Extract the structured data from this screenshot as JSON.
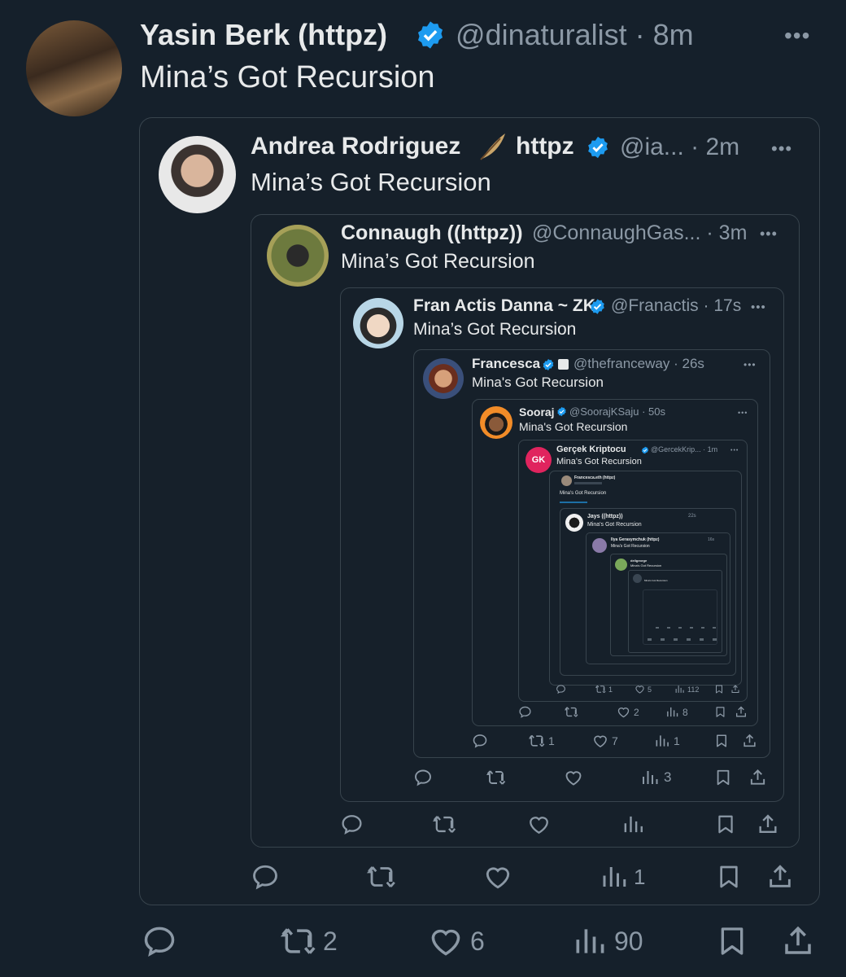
{
  "tweet": {
    "author": "Yasin Berk (httpz)",
    "handle": "@dinaturalist",
    "time": "8m",
    "text": "Mina’s Got Recursion",
    "more": "•••",
    "stats": {
      "replies": "",
      "retweets": "2",
      "likes": "6",
      "views": "90"
    }
  },
  "q1": {
    "author": "Andrea Rodriguez",
    "emoji_after": "httpz",
    "handle": "@ia...",
    "time": "2m",
    "text": "Mina’s Got Recursion",
    "more": "•••",
    "stats": {
      "views": "1"
    }
  },
  "q2": {
    "author": "Connaugh ((httpz))",
    "handle": "@ConnaughGas...",
    "time": "3m",
    "text": "Mina’s Got Recursion",
    "more": "•••"
  },
  "q3": {
    "author": "Fran Actis Danna ~ ZK",
    "handle": "@Franactis",
    "time": "17s",
    "text": "Mina’s Got Recursion",
    "more": "•••",
    "stats": {
      "views": "3"
    }
  },
  "q4": {
    "author": "Francesca",
    "handle": "@thefranceway",
    "time": "26s",
    "text": "Mina's Got Recursion",
    "more": "•••",
    "stats": {
      "retweets": "1",
      "likes": "7",
      "views": "1"
    }
  },
  "q5": {
    "author": "Sooraj",
    "handle": "@SoorajKSaju",
    "time": "50s",
    "text": "Mina's Got Recursion",
    "more": "•••",
    "stats": {
      "likes": "2",
      "views": "8"
    }
  },
  "q6": {
    "author": "Gerçek Kriptocu",
    "handle": "@GercekKrip...",
    "time": "1m",
    "text": "Mina's Got Recursion",
    "avatar_text": "GK",
    "more": "•••",
    "stats": {
      "retweets": "1",
      "likes": "5",
      "views": "112"
    }
  },
  "q7": {
    "author": "Francesca.eth (httpz)",
    "text": "Mina's Got Recursion"
  },
  "q8": {
    "author": "Jays",
    "handle": "((httpz))",
    "time": "22s",
    "text": "Mina's Got Recursion"
  },
  "q9": {
    "author": "Ilya Gerasymchuk (httpz)",
    "time": "16s",
    "text": "Mina's Got Recursion"
  },
  "q10": {
    "author": "dellgeorge",
    "text": "Mina's Got Recursion"
  },
  "q11": {
    "text": "Mina's Got Recursion"
  },
  "colors": {
    "background": "#15202b",
    "text": "#e7e9ea",
    "muted": "#8b98a5",
    "verified": "#1d9bf0",
    "border": "#38444d",
    "gk_red": "#e0245e"
  }
}
